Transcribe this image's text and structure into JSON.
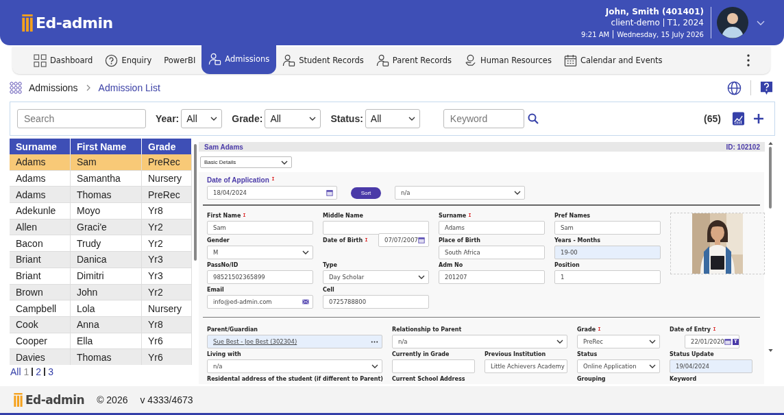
{
  "header": {
    "logo": "Ed-admin",
    "user": "John, Smith (401401)",
    "client": "client-demo",
    "term": "T1, 2024",
    "time": "9:21 AM",
    "date": "Wednesday, 15 July 2026"
  },
  "nav": [
    {
      "label": "Dashboard",
      "kind": "grid",
      "selected": false
    },
    {
      "label": "Enquiry",
      "kind": "question",
      "selected": false
    },
    {
      "label": "PowerBI",
      "kind": "plain",
      "selected": false
    },
    {
      "label": "Admissions",
      "kind": "person",
      "selected": true
    },
    {
      "label": "Student Records",
      "kind": "person",
      "selected": false
    },
    {
      "label": "Parent Records",
      "kind": "person",
      "selected": false
    },
    {
      "label": "Human Resources",
      "kind": "hand",
      "selected": false
    },
    {
      "label": "Calendar and Events",
      "kind": "calendar",
      "selected": false
    }
  ],
  "breadcrumb": [
    "Admissions",
    "Admission List"
  ],
  "filters": {
    "search": {
      "placeholder": "Search"
    },
    "selects": [
      {
        "label": "Year:",
        "value": "All"
      },
      {
        "label": "Grade:",
        "value": "All"
      },
      {
        "label": "Status:",
        "value": "All"
      }
    ],
    "keyword": {
      "placeholder": "Keyword"
    },
    "count": "(65)"
  },
  "table": {
    "columns": [
      "Surname",
      "First Name",
      "Grade"
    ],
    "rows": [
      {
        "cells": [
          "Adams",
          "Sam",
          "PreRec"
        ],
        "selected": true
      },
      {
        "cells": [
          "Adams",
          "Samantha",
          "Nursery"
        ],
        "selected": false
      },
      {
        "cells": [
          "Adams",
          "Thomas",
          "PreRec"
        ],
        "selected": false
      },
      {
        "cells": [
          "Adekunle",
          "Moyo",
          "Yr8"
        ],
        "selected": false
      },
      {
        "cells": [
          "Allen",
          "Graci'e",
          "Yr2"
        ],
        "selected": false
      },
      {
        "cells": [
          "Bacon",
          "Trudy",
          "Yr2"
        ],
        "selected": false
      },
      {
        "cells": [
          "Briant",
          "Danica",
          "Yr3"
        ],
        "selected": false
      },
      {
        "cells": [
          "Briant",
          "Dimitri",
          "Yr3"
        ],
        "selected": false
      },
      {
        "cells": [
          "Brown",
          "John",
          "Yr2"
        ],
        "selected": false
      },
      {
        "cells": [
          "Campbell",
          "Lola",
          "Nursery"
        ],
        "selected": false
      },
      {
        "cells": [
          "Cook",
          "Anna",
          "Yr8"
        ],
        "selected": false
      },
      {
        "cells": [
          "Cooper",
          "Ella",
          "Yr6"
        ],
        "selected": false
      },
      {
        "cells": [
          "Davies",
          "Thomas",
          "Yr6"
        ],
        "selected": false
      }
    ]
  },
  "pagination": [
    {
      "label": "All",
      "selected": false
    },
    {
      "label": "1",
      "selected": true
    },
    {
      "label": "2",
      "selected": false
    },
    {
      "label": "3",
      "selected": false
    }
  ],
  "detail": {
    "name": "Sam Adams",
    "id": "ID: 102102",
    "section": "Basic Details",
    "application": {
      "label": "Date of Application",
      "required": true,
      "value": "18/04/2024",
      "sort_button": "Sort",
      "sort_value": "n/a"
    },
    "personal": [
      {
        "label": "First Name",
        "required": true,
        "kind": "text",
        "value": "Sam"
      },
      {
        "label": "Middle Name",
        "required": false,
        "kind": "text"
      },
      {
        "label": "Surname",
        "required": true,
        "kind": "text",
        "value": "Adams"
      },
      {
        "label": "Pref Names",
        "required": false,
        "kind": "text",
        "value": "Sam"
      },
      {
        "label": "Gender",
        "required": false,
        "kind": "select",
        "value": "M"
      },
      {
        "label": "Date of Birth",
        "required": true,
        "kind": "date_inline",
        "value": "07/07/2007"
      },
      {
        "label": "Place of Birth",
        "required": false,
        "kind": "text",
        "value": "South Africa"
      },
      {
        "label": "Years - Months",
        "required": false,
        "kind": "readonly",
        "value": "19-00"
      },
      {
        "label": "PassNo/ID",
        "required": false,
        "kind": "text",
        "value": "98521502365899"
      },
      {
        "label": "Type",
        "required": false,
        "kind": "select",
        "value": "Day Scholar"
      },
      {
        "label": "Adm No",
        "required": false,
        "kind": "text",
        "value": "201207"
      },
      {
        "label": "Position",
        "required": false,
        "kind": "text",
        "value": "1"
      },
      {
        "label": "Email",
        "required": false,
        "kind": "email",
        "value": "info@ed-admin.com"
      },
      {
        "label": "Cell",
        "required": false,
        "kind": "text",
        "value": "0725788800"
      }
    ],
    "family": [
      {
        "label": "Parent/Guardian",
        "required": false,
        "kind": "lookup",
        "value": " Sue Best -  Joe Best (302304)",
        "wide": true
      },
      {
        "label": "Relationship to Parent",
        "required": false,
        "kind": "select",
        "value": "n/a",
        "wide": true
      },
      {
        "label": "Grade",
        "required": true,
        "kind": "select",
        "value": "PreRec",
        "wide": false
      },
      {
        "label": "Date of Entry",
        "required": true,
        "kind": "date",
        "value": "22/01/2020",
        "button": "T",
        "wide": false
      },
      {
        "label": "Living with",
        "required": false,
        "kind": "select",
        "value": "n/a",
        "wide": true
      },
      {
        "label": "Currently in Grade",
        "required": false,
        "kind": "text",
        "wide": false
      },
      {
        "label": "Previous Institution",
        "required": false,
        "kind": "text",
        "value": "Little Achievers Academy",
        "wide": false
      },
      {
        "label": "Status",
        "required": false,
        "kind": "select",
        "value": "Online Application",
        "wide": false
      },
      {
        "label": "Status Update",
        "required": false,
        "kind": "readonly",
        "value": "19/04/2024",
        "wide": false
      },
      {
        "label": "Residental address of the student (if different to Parent)",
        "required": false,
        "kind": "label",
        "wide": true
      },
      {
        "label": "Current School Address",
        "required": false,
        "kind": "label",
        "wide": true
      },
      {
        "label": "Grouping",
        "required": false,
        "kind": "label",
        "wide": false
      },
      {
        "label": "Keyword",
        "required": false,
        "kind": "label",
        "wide": false
      }
    ]
  },
  "footer": {
    "logo": "Ed-admin",
    "copyright": "© 2026",
    "version": "v 4333/4673"
  }
}
